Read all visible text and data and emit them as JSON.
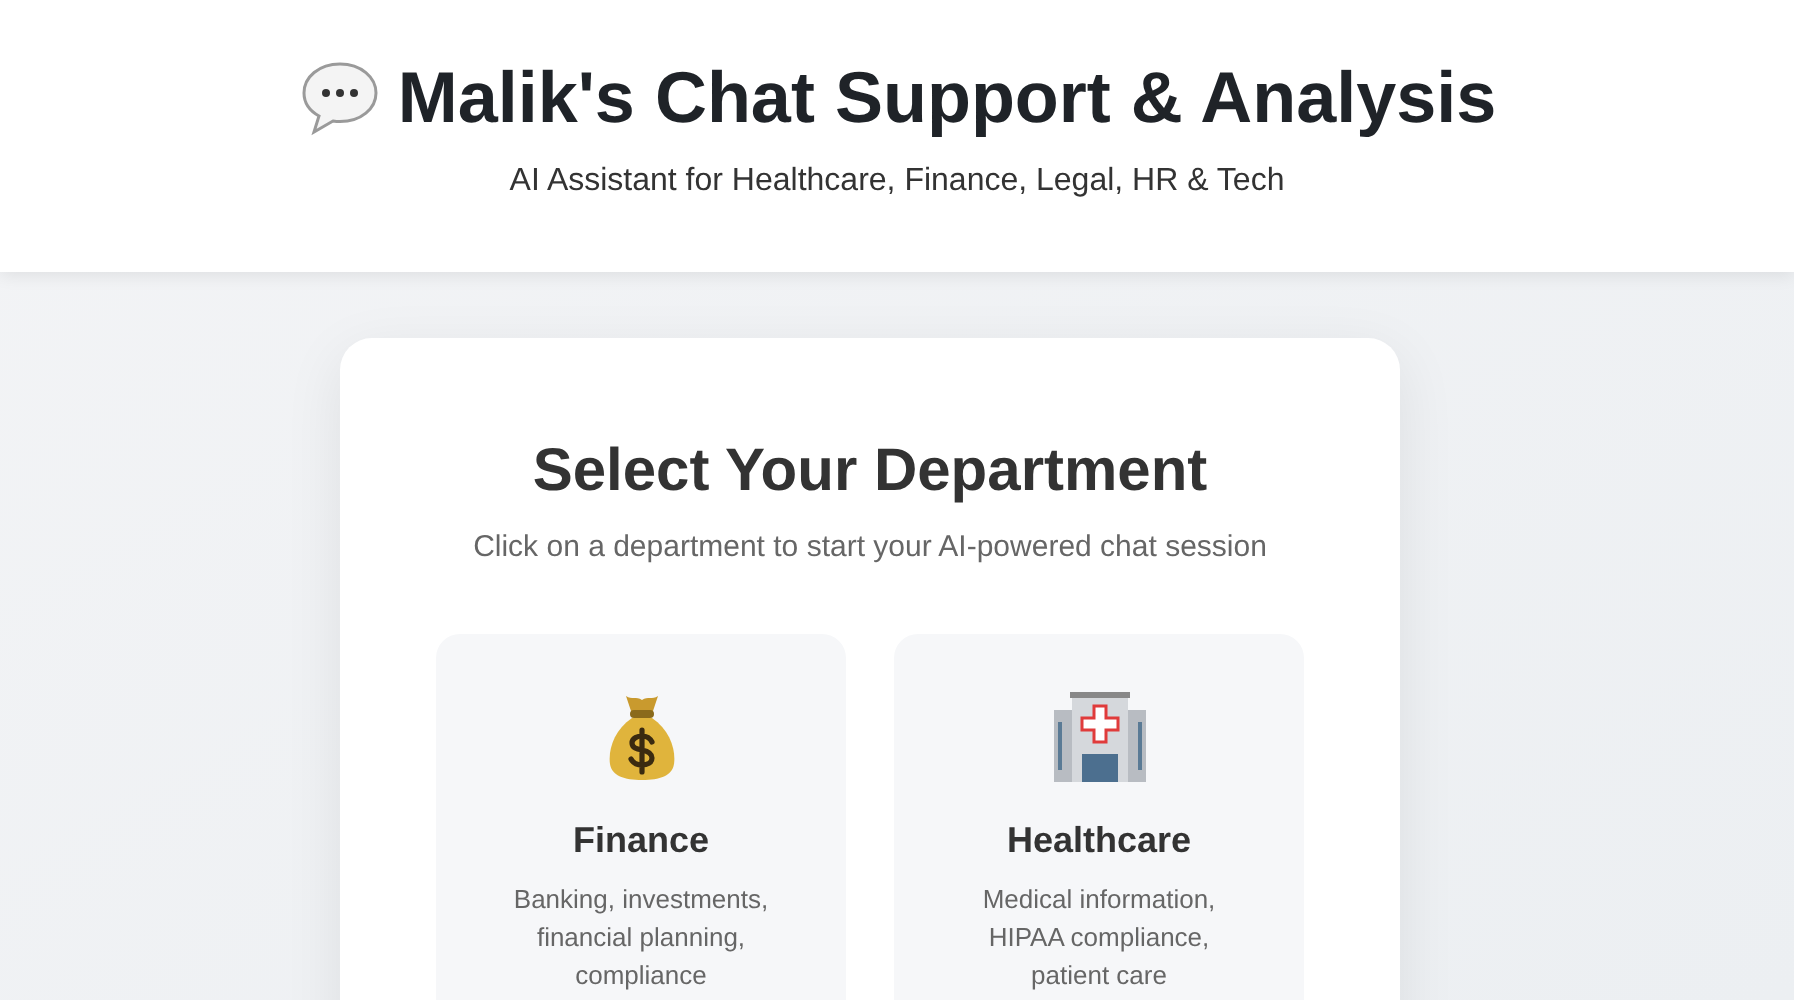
{
  "header": {
    "title": "Malik's Chat Support & Analysis",
    "subtitle": "AI Assistant for Healthcare, Finance, Legal, HR & Tech"
  },
  "panel": {
    "title": "Select Your Department",
    "subtitle": "Click on a department to start your AI-powered chat session"
  },
  "departments": [
    {
      "name": "Finance",
      "description": "Banking, investments, financial planning, compliance"
    },
    {
      "name": "Healthcare",
      "description": "Medical information, HIPAA compliance, patient care"
    }
  ]
}
